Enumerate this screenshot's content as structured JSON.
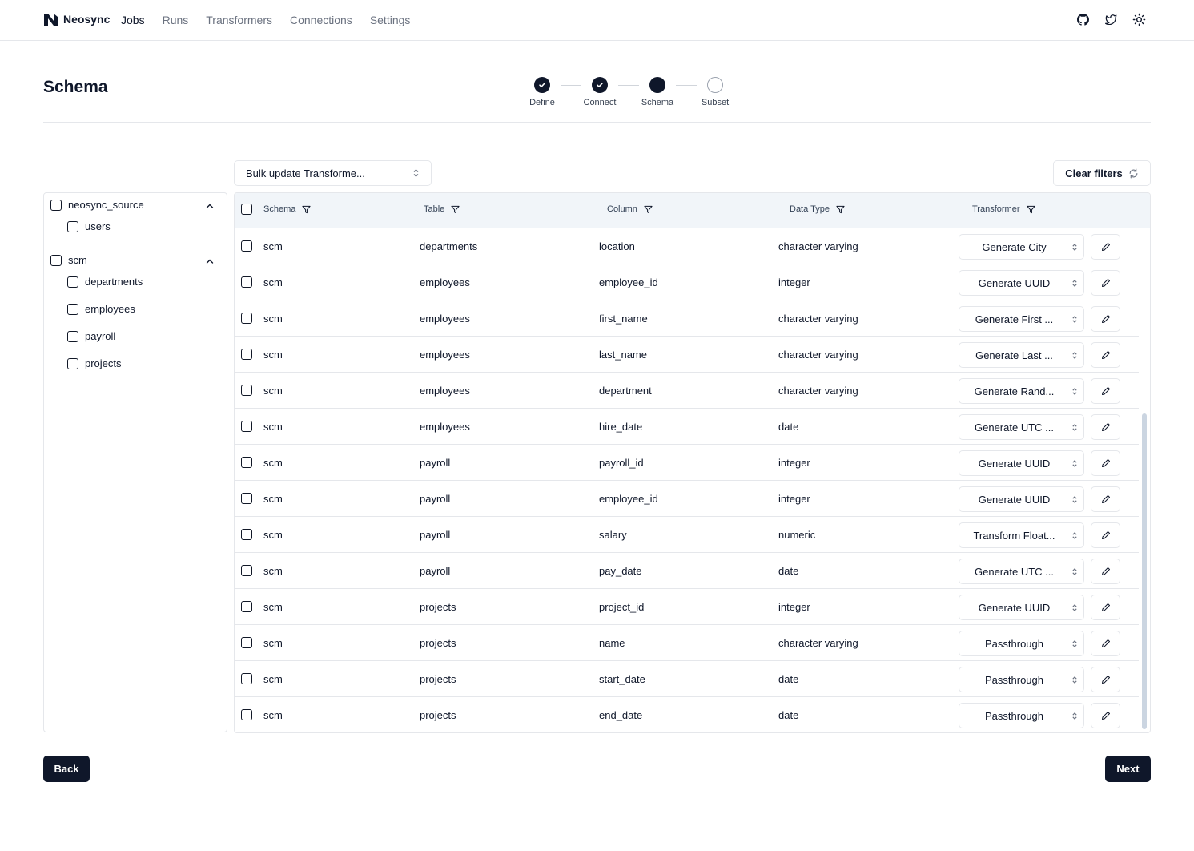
{
  "nav": {
    "brand": "Neosync",
    "links": [
      "Jobs",
      "Runs",
      "Transformers",
      "Connections",
      "Settings"
    ],
    "active_link": "Jobs",
    "icons": [
      "github-icon",
      "twitter-icon",
      "sun-icon"
    ]
  },
  "page": {
    "title": "Schema"
  },
  "stepper": {
    "steps": [
      {
        "label": "Define",
        "state": "done"
      },
      {
        "label": "Connect",
        "state": "done"
      },
      {
        "label": "Schema",
        "state": "current"
      },
      {
        "label": "Subset",
        "state": "todo"
      }
    ]
  },
  "toolbar": {
    "bulk_update_label": "Bulk update Transforme...",
    "clear_filters_label": "Clear filters"
  },
  "tree": {
    "groups": [
      {
        "name": "neosync_source",
        "tables": [
          "users"
        ]
      },
      {
        "name": "scm",
        "tables": [
          "departments",
          "employees",
          "payroll",
          "projects"
        ]
      }
    ]
  },
  "table": {
    "columns": [
      "Schema",
      "Table",
      "Column",
      "Data Type",
      "Transformer"
    ],
    "rows": [
      {
        "schema": "scm",
        "table": "departments",
        "column": "location",
        "data_type": "character varying",
        "transformer": "Generate City"
      },
      {
        "schema": "scm",
        "table": "employees",
        "column": "employee_id",
        "data_type": "integer",
        "transformer": "Generate UUID"
      },
      {
        "schema": "scm",
        "table": "employees",
        "column": "first_name",
        "data_type": "character varying",
        "transformer": "Generate First ..."
      },
      {
        "schema": "scm",
        "table": "employees",
        "column": "last_name",
        "data_type": "character varying",
        "transformer": "Generate Last ..."
      },
      {
        "schema": "scm",
        "table": "employees",
        "column": "department",
        "data_type": "character varying",
        "transformer": "Generate Rand..."
      },
      {
        "schema": "scm",
        "table": "employees",
        "column": "hire_date",
        "data_type": "date",
        "transformer": "Generate UTC ..."
      },
      {
        "schema": "scm",
        "table": "payroll",
        "column": "payroll_id",
        "data_type": "integer",
        "transformer": "Generate UUID"
      },
      {
        "schema": "scm",
        "table": "payroll",
        "column": "employee_id",
        "data_type": "integer",
        "transformer": "Generate UUID"
      },
      {
        "schema": "scm",
        "table": "payroll",
        "column": "salary",
        "data_type": "numeric",
        "transformer": "Transform Float..."
      },
      {
        "schema": "scm",
        "table": "payroll",
        "column": "pay_date",
        "data_type": "date",
        "transformer": "Generate UTC ..."
      },
      {
        "schema": "scm",
        "table": "projects",
        "column": "project_id",
        "data_type": "integer",
        "transformer": "Generate UUID"
      },
      {
        "schema": "scm",
        "table": "projects",
        "column": "name",
        "data_type": "character varying",
        "transformer": "Passthrough"
      },
      {
        "schema": "scm",
        "table": "projects",
        "column": "start_date",
        "data_type": "date",
        "transformer": "Passthrough"
      },
      {
        "schema": "scm",
        "table": "projects",
        "column": "end_date",
        "data_type": "date",
        "transformer": "Passthrough"
      }
    ]
  },
  "footer": {
    "back_label": "Back",
    "next_label": "Next"
  },
  "colors": {
    "primary": "#0f172a",
    "border": "#e5e7eb",
    "header_bg": "#f1f5f9",
    "muted_text": "#6b7280"
  }
}
